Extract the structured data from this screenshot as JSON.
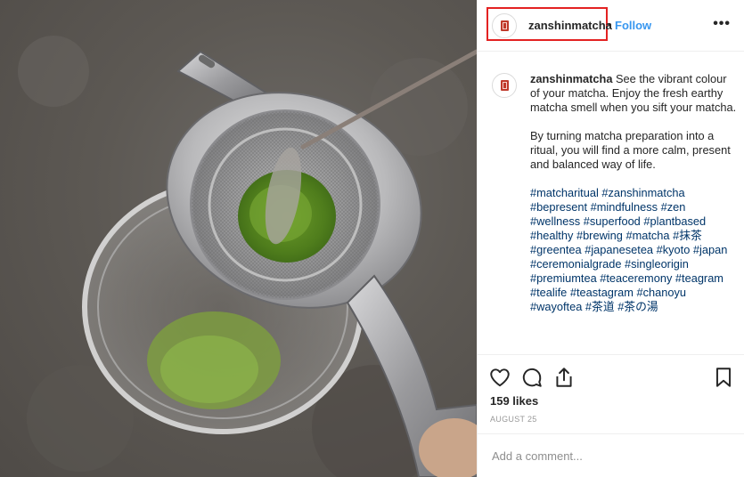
{
  "post": {
    "username": "zanshinmatcha",
    "follow_label": "Follow",
    "separator": "•",
    "more_label": "•••",
    "photo_alt": "Matcha sifted through a steel strainer over a glass bowl"
  },
  "caption": {
    "username": "zanshinmatcha",
    "paragraph1": " See the vibrant colour of your matcha. Enjoy the fresh earthy matcha smell when you sift your matcha.",
    "paragraph2": "By turning matcha preparation into a ritual, you will find a more calm, present and balanced way of life.",
    "hashtags": [
      "#matcharitual",
      "#zanshinmatcha",
      "#bepresent",
      "#mindfulness",
      "#zen",
      "#wellness",
      "#superfood",
      "#plantbased",
      "#healthy",
      "#brewing",
      "#matcha",
      "#抹茶",
      "#greentea",
      "#japanesetea",
      "#kyoto",
      "#japan",
      "#ceremonialgrade",
      "#singleorigin",
      "#premiumtea",
      "#teaceremony",
      "#teagram",
      "#tealife",
      "#teastagram",
      "#chanoyu",
      "#wayoftea",
      "#茶道",
      "#茶の湯"
    ]
  },
  "stats": {
    "likes": "159 likes",
    "date": "AUGUST 25"
  },
  "comment": {
    "placeholder": "Add a comment..."
  },
  "icons": [
    "heart-icon",
    "comment-icon",
    "share-icon",
    "bookmark-icon",
    "more-icon"
  ],
  "colors": {
    "link": "#3897f0",
    "hashtag": "#003569",
    "highlight": "#e32222",
    "text": "#262626",
    "muted": "#8e8e8e"
  }
}
